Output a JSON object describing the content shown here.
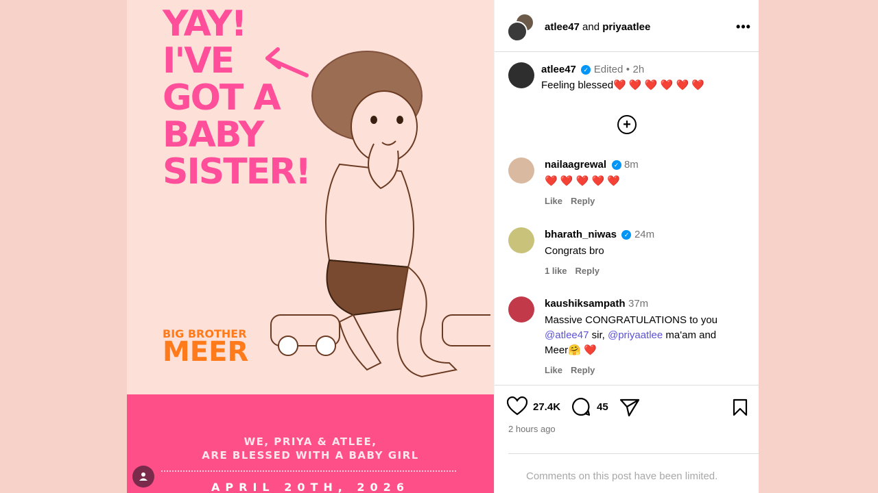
{
  "image": {
    "headline_lines": [
      "YAY!",
      "I'VE",
      "GOT A",
      "BABY",
      "SISTER!"
    ],
    "big_brother": "BIG BROTHER",
    "name": "MEER",
    "announce_line1": "WE, PRIYA & ATLEE,",
    "announce_line2": "ARE BLESSED WITH A BABY GIRL",
    "date": "APRIL 20TH, 2026",
    "colors": {
      "background": "#fde0d8",
      "headline": "#ff4f9a",
      "accent": "#ff7a1a",
      "band": "#ff4f88"
    },
    "tag_icon": "user-icon"
  },
  "header": {
    "user1": "atlee47",
    "joiner": "and",
    "user2": "priyaatlee",
    "more_icon": "more-horizontal-icon"
  },
  "caption": {
    "username": "atlee47",
    "edited": "Edited",
    "separator": "•",
    "time": "2h",
    "text": "Feeling blessed",
    "hearts": "❤️ ❤️ ❤️ ❤️ ❤️ ❤️"
  },
  "load_more_icon": "plus-circle-icon",
  "comments": [
    {
      "username": "nailaagrewal",
      "verified": true,
      "time": "8m",
      "text": "❤️ ❤️ ❤️ ❤️ ❤️",
      "like": "Like",
      "reply": "Reply"
    },
    {
      "username": "bharath_niwas",
      "verified": true,
      "time": "24m",
      "text": "Congrats bro",
      "like": "1 like",
      "reply": "Reply"
    },
    {
      "username": "kaushiksampath",
      "verified": false,
      "time": "37m",
      "text_pre": "Massive CONGRATULATIONS to you",
      "mention1": "@atlee47",
      "mid1": " sir, ",
      "mention2": "@priyaatlee",
      "mid2": " ma'am and",
      "text_post": "Meer🤗 ❤️",
      "like": "Like",
      "reply": "Reply"
    }
  ],
  "actions": {
    "likes": "27.4K",
    "comments": "45",
    "timestamp": "2 hours ago"
  },
  "limited": "Comments on this post have been limited."
}
